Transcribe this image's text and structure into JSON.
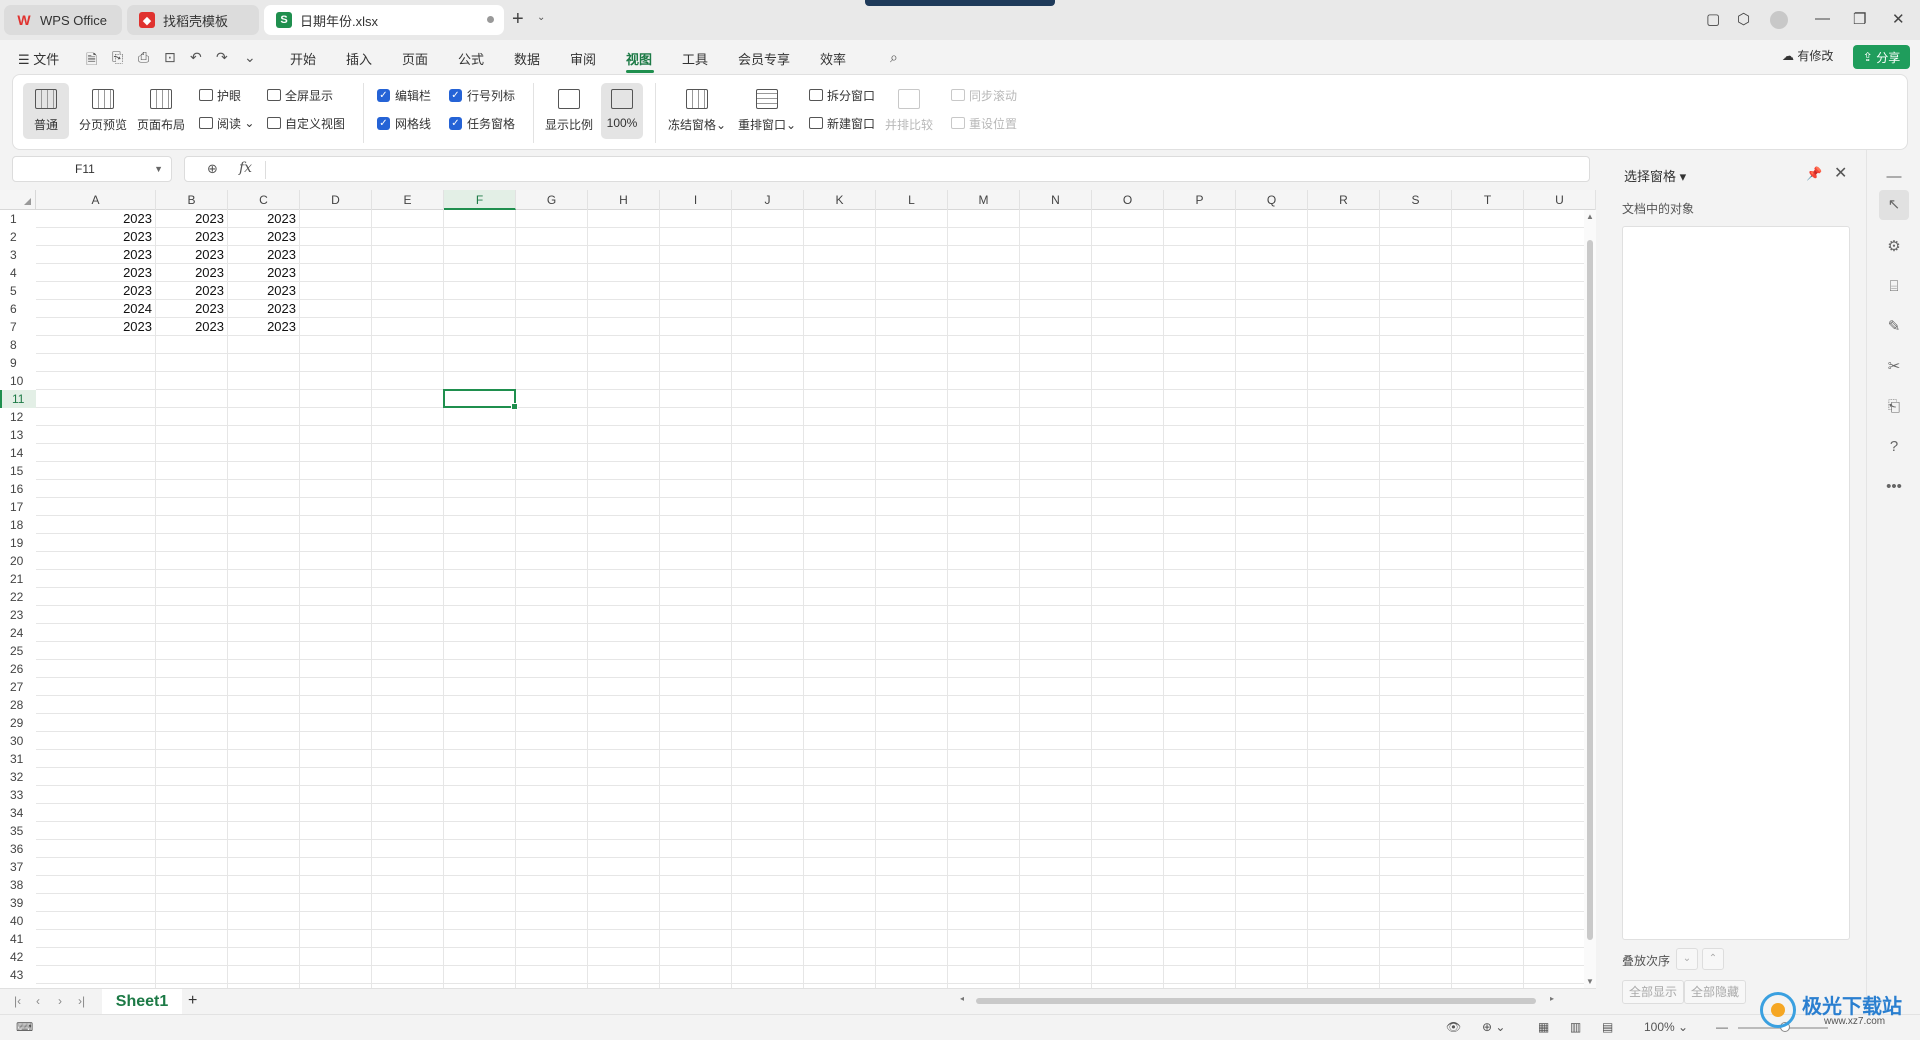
{
  "titlebar": {
    "tabs": [
      {
        "label": "WPS Office"
      },
      {
        "label": "找稻壳模板"
      },
      {
        "label": "日期年份.xlsx"
      }
    ],
    "new_tab": "+"
  },
  "menu": {
    "file": "文件",
    "items": [
      "开始",
      "插入",
      "页面",
      "公式",
      "数据",
      "审阅",
      "视图",
      "工具",
      "会员专享",
      "效率"
    ],
    "active": "视图",
    "modified": "有修改",
    "share": "分享"
  },
  "ribbon": {
    "normal": "普通",
    "page_break": "分页预览",
    "page_layout": "页面布局",
    "eye_care": "护眼",
    "reading": "阅读",
    "fullscreen": "全屏显示",
    "custom_view": "自定义视图",
    "edit_bar": "编辑栏",
    "row_col_header": "行号列标",
    "gridlines": "网格线",
    "task_pane": "任务窗格",
    "zoom": "显示比例",
    "zoom_100": "100%",
    "freeze": "冻结窗格",
    "arrange": "重排窗口",
    "split": "拆分窗口",
    "new_window": "新建窗口",
    "side_by_side": "并排比较",
    "sync_scroll": "同步滚动",
    "reset_position": "重设位置"
  },
  "formula_bar": {
    "cell_ref": "F11",
    "fx": "fx",
    "value": ""
  },
  "sheet": {
    "columns": [
      "A",
      "B",
      "C",
      "D",
      "E",
      "F",
      "G",
      "H",
      "I",
      "J",
      "K",
      "L",
      "M",
      "N",
      "O",
      "P",
      "Q",
      "R",
      "S",
      "T",
      "U"
    ],
    "selected_column": "F",
    "row_count": 43,
    "selected_row": 11,
    "data": [
      [
        "2023",
        "2023",
        "2023"
      ],
      [
        "2023",
        "2023",
        "2023"
      ],
      [
        "2023",
        "2023",
        "2023"
      ],
      [
        "2023",
        "2023",
        "2023"
      ],
      [
        "2023",
        "2023",
        "2023"
      ],
      [
        "2024",
        "2023",
        "2023"
      ],
      [
        "2023",
        "2023",
        "2023"
      ]
    ],
    "tab": "Sheet1",
    "add_sheet": "+"
  },
  "pane": {
    "title": "选择窗格",
    "objects_label": "文档中的对象",
    "order_label": "叠放次序",
    "show_all": "全部显示",
    "hide_all": "全部隐藏"
  },
  "status": {
    "zoom": "100%"
  },
  "watermark": {
    "name": "极光下载站",
    "url": "www.xz7.com"
  }
}
